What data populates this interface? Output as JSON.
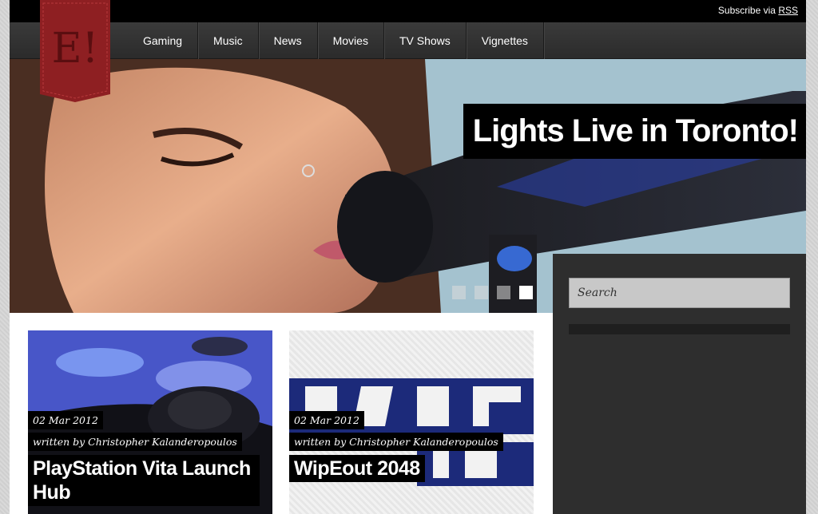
{
  "header": {
    "subscribe_text": "Subscribe via",
    "subscribe_link": "RSS",
    "logo_text": "E!"
  },
  "nav": {
    "items": [
      {
        "label": "Gaming"
      },
      {
        "label": "Music"
      },
      {
        "label": "News"
      },
      {
        "label": "Movies"
      },
      {
        "label": "TV Shows"
      },
      {
        "label": "Vignettes"
      }
    ]
  },
  "hero": {
    "title": "Lights Live in Toronto!",
    "slide_count": 4,
    "active_slide": 4
  },
  "sidebar": {
    "search_placeholder": "Search"
  },
  "posts": [
    {
      "date": "02 Mar 2012",
      "author": "written by Christopher Kalanderopoulos",
      "title": "PlayStation Vita Launch Hub"
    },
    {
      "date": "02 Mar 2012",
      "author": "written by Christopher Kalanderopoulos",
      "title": "WipEout 2048"
    }
  ],
  "colors": {
    "logo_red": "#8e1f22",
    "background_dark": "#2a2a2a",
    "top_bar": "#000000"
  }
}
